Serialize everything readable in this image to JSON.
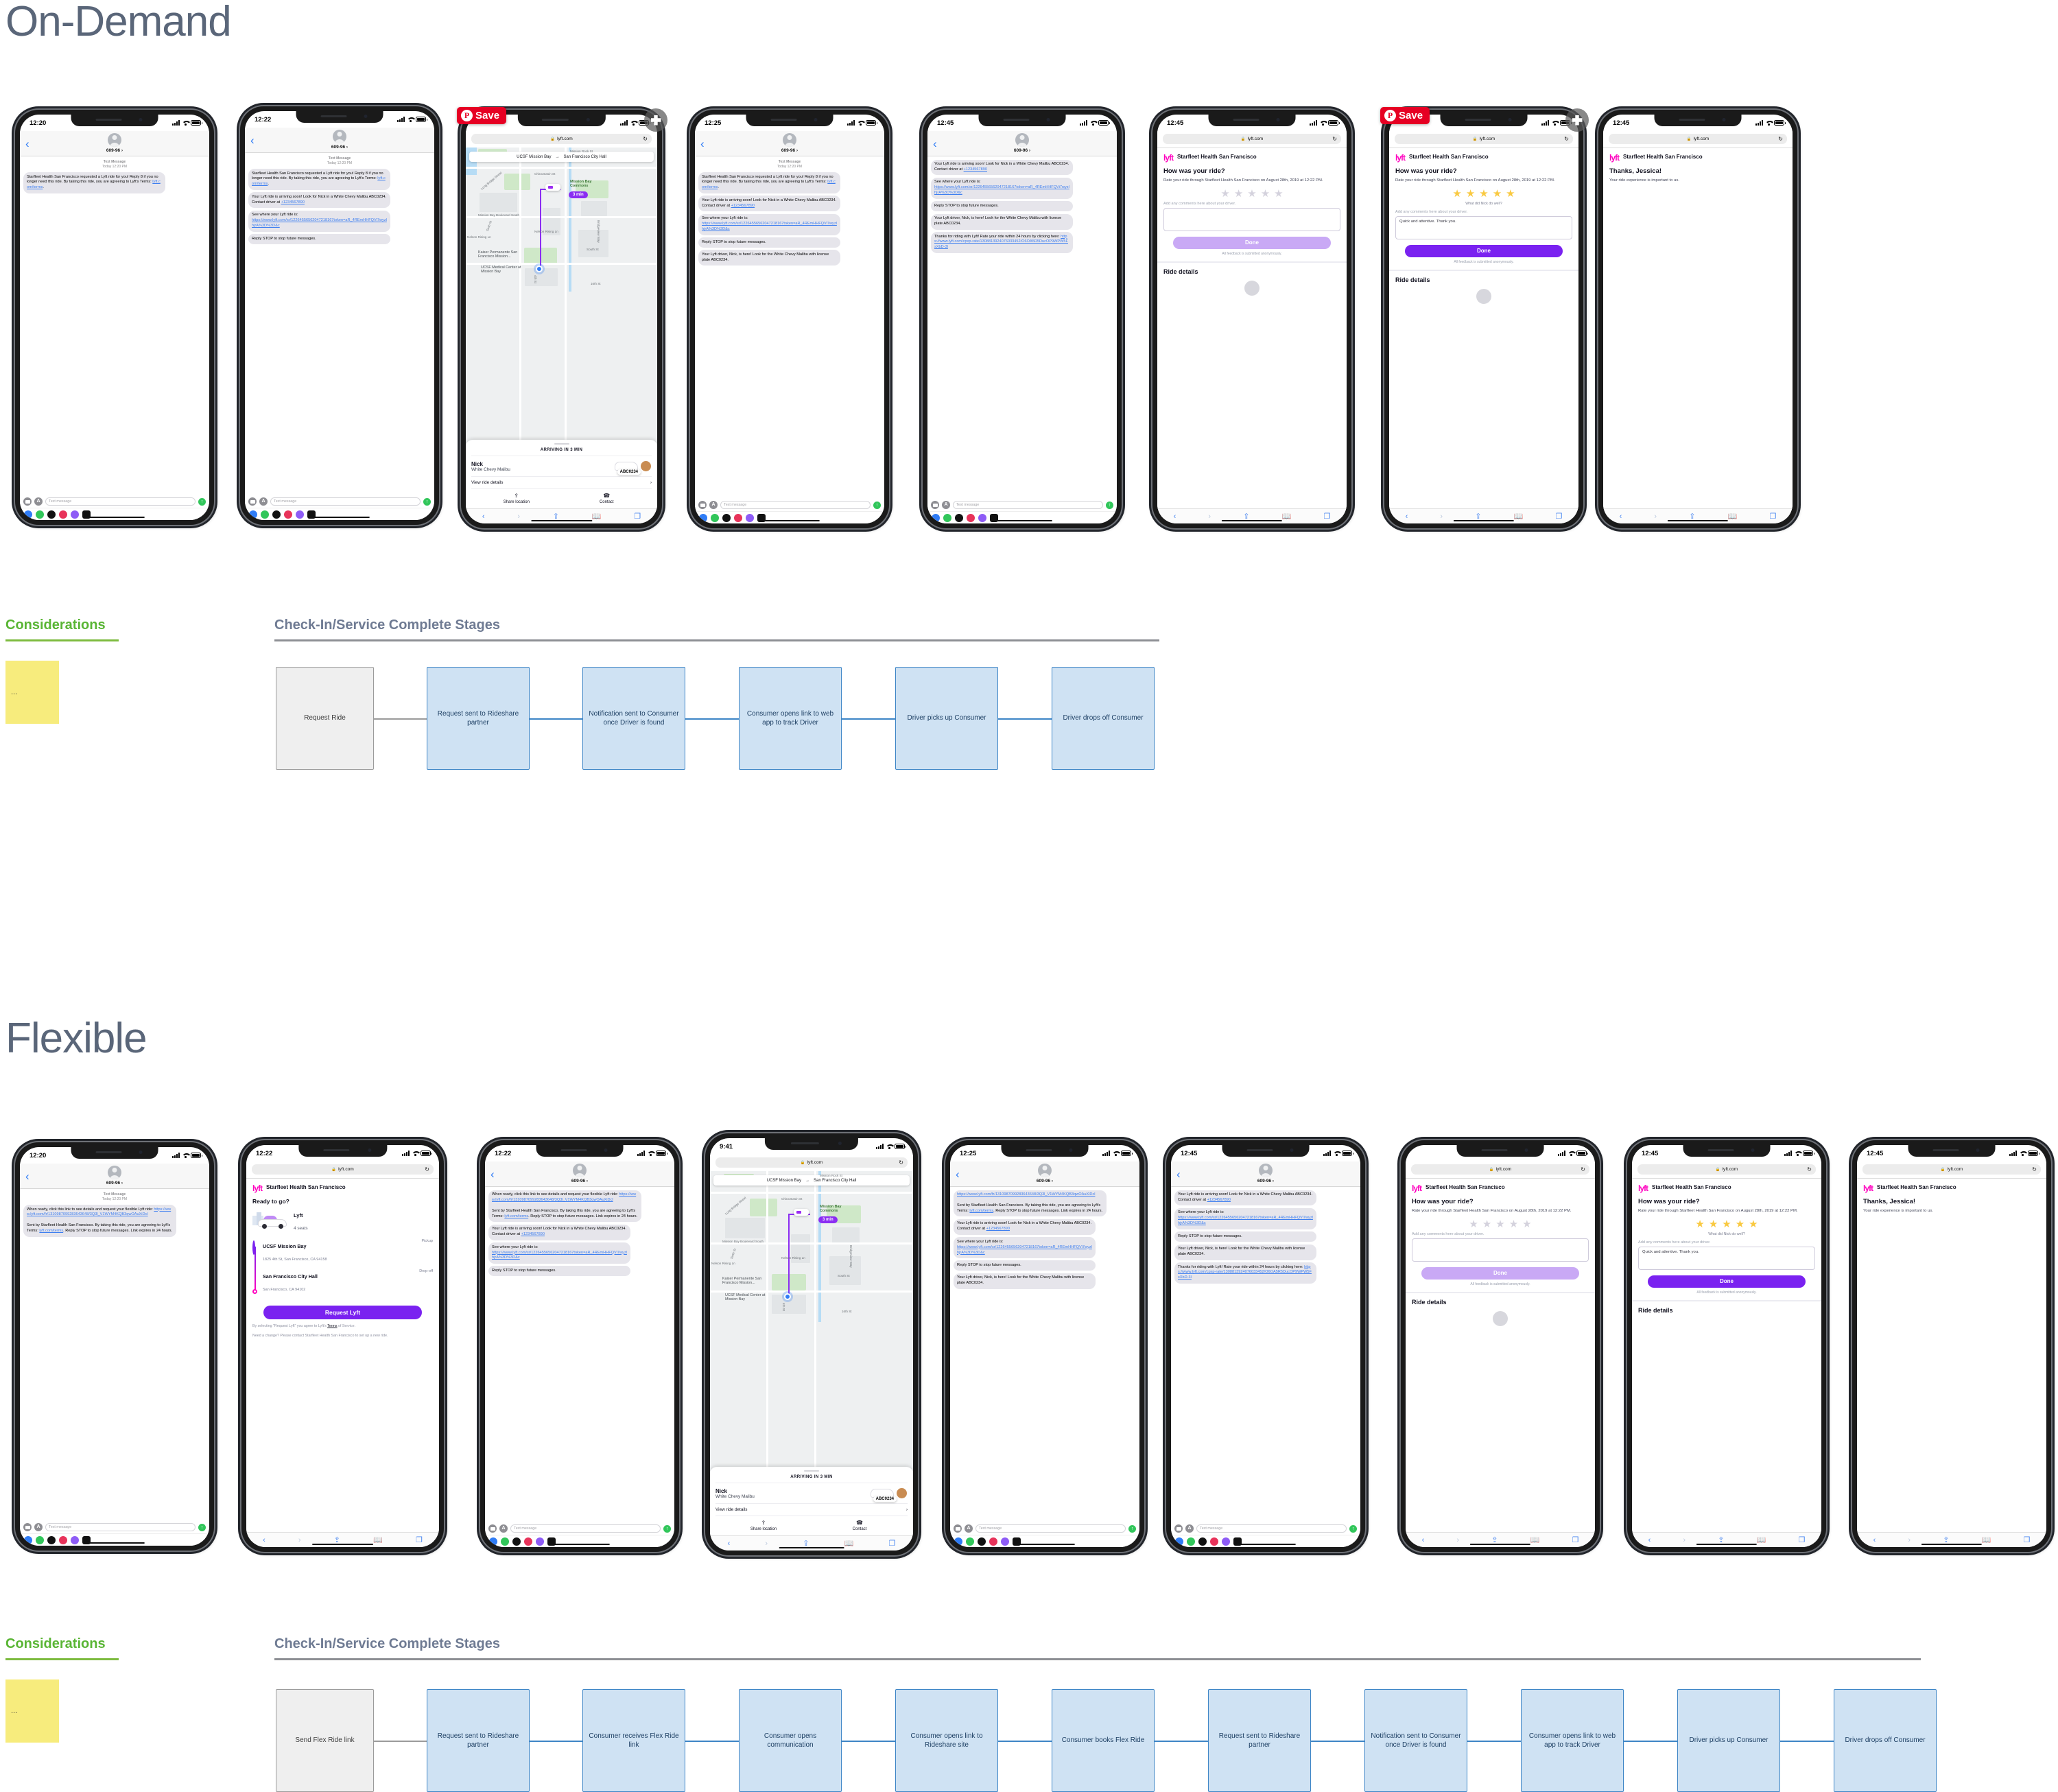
{
  "sections": {
    "ondemand": {
      "title": "On-Demand"
    },
    "flexible": {
      "title": "Flexible"
    }
  },
  "considerations": {
    "title": "Considerations",
    "note": "..."
  },
  "stages": {
    "title": "Check-In/Service Complete Stages"
  },
  "sms": {
    "contact": "609-96",
    "text_message_label": "Text Message",
    "timestamp": "Today 12:20 PM",
    "input_placeholder": "Text message",
    "msg_request": "Starfleet Health San Francisco requested a Lyft ride for you! Reply 8 if you no longer need this ride. By taking this ride, you are agreeing to Lyft's Terms: ",
    "msg_request_link": "lyft.com/terms",
    "msg_arriving_a": "Your Lyft ride is arriving soon! Look for Nick in a White Chevy Malibu ABC0234. Contact driver at ",
    "msg_arriving_link": "+1234567890",
    "msg_track_a": "See where your Lyft ride is:",
    "msg_track_link": "https://www.lyft.com/sr/12264556562047218167token=aR_4REmHHFQVi7wyzlhjrA%3D%3D&c",
    "msg_stop": "Reply STOP to stop future messages.",
    "msg_here": "Your Lyft driver, Nick, is here! Look for the White Chevy Malibu with license plate ABC0234.",
    "msg_rate_a": "Thanks for riding with Lyft! Rate your ride within 24 hours by clicking here: ",
    "msg_rate_link": "https://www.lyft.com/cpxp-rate/1308813924076033452/O6OA5R5DucOP9WPW5FsXbD-3l",
    "msg_flex_a": "When ready, click this link to see details and request your flexible Lyft ride: ",
    "msg_flex_link": "https://www.lyft.com/fr/1310987099283643648/3Q3l_V1WYM4KQB3qwOAuXiDcl",
    "msg_flex_b": "Sent by Starfleet Health San Francisco. By taking this ride, you are agreeing to Lyft's Terms: ",
    "msg_flex_b_link": "lyft.com/terms",
    "msg_flex_b_tail": ". Reply STOP to stop future messages. Link expires in 24 hours."
  },
  "browser": {
    "url": "lyft.com",
    "lock_icon": "lock-icon",
    "reload_icon": "reload-icon"
  },
  "rating": {
    "logo": "lyft",
    "org": "Starfleet Health San Francisco",
    "heading": "How was your ride?",
    "sub": "Rate your ride through Starfleet Health San Francisco on August 28th, 2019 at 12:22 PM.",
    "star_caption": "What did Nick do well?",
    "comments_label": "Add any comments here about your driver.",
    "comment_value": "Quick and attentive. Thank you.",
    "done": "Done",
    "anon": "All feedback is submitted anonymously.",
    "ride_details": "Ride details",
    "stars_empty": 0,
    "stars_filled": 5,
    "color_pale": "#c9a9f5",
    "color_solid": "#7a22f0",
    "color_star": "#f9c941"
  },
  "thanks": {
    "org": "Starfleet Health San Francisco",
    "heading": "Thanks, Jessica!",
    "sub": "Your ride experience is important to us."
  },
  "ready": {
    "org": "Starfleet Health San Francisco",
    "heading": "Ready to go?",
    "ride_type": "Lyft",
    "seats": "4 seats",
    "pickup_name": "UCSF Mission Bay",
    "pickup_addr": "1825 4th St, San Francisco, CA 94158",
    "pickup_tag": "Pickup",
    "dropoff_name": "San Francisco City Hall",
    "dropoff_addr": "San Francisco, CA 94102",
    "dropoff_tag": "Drop-off",
    "cta": "Request Lyft",
    "terms_a": "By selecting \"Request Lyft\" you agree to Lyft's ",
    "terms_link": "Terms",
    "terms_b": " of Service.",
    "change": "Need a change? Please contact Starfleet Health San Francisco to set up a new ride."
  },
  "map": {
    "origin": "UCSF Mission Bay",
    "destination": "San Francisco City Hall",
    "eta_badge": "3 min",
    "arriving": "ARRIVING IN 3 MIN",
    "driver_name": "Nick",
    "driver_car": "White Chevy Malibu",
    "plate": "ABC0234",
    "view_details": "View ride details",
    "share": "Share location",
    "contact": "Contact",
    "labels": {
      "mission_rock": "Mission Rock St",
      "china_basin": "China Basin St",
      "long_bridge": "Long Bridge Street",
      "mission_bay_blvd": "Mission Bay Boulevard South",
      "sixth_st": "Sixth St",
      "nelson_rising": "Nelson Rising Ln",
      "nelson_rising2": "Nelson Rising Ln",
      "mission_bay_commons": "Mission Bay Commons",
      "bridgeview": "Bridgeview Way",
      "south_st": "South St",
      "kaiser": "Kaiser Permanente San Francisco Mission...",
      "ucsf_med": "UCSF Medical Center at Mission Bay",
      "fourth_st": "4th St",
      "sixteenth": "16th St",
      "tunnel": "Tunnel St"
    }
  },
  "pinterest": {
    "save_label": "Save",
    "logo": "pinterest-icon",
    "more": "more-options-icon"
  },
  "statusbars": {
    "t1220": "12:20",
    "t1222": "12:22",
    "t1225": "12:25",
    "t1245": "12:45",
    "t941": "9:41"
  },
  "flow_ondemand": {
    "steps": [
      "Request Ride",
      "Request sent to Rideshare partner",
      "Notification sent to Consumer once Driver is found",
      "Consumer opens link to web app to track Driver",
      "Driver picks up Consumer",
      "Driver drops off Consumer"
    ]
  },
  "flow_flexible": {
    "steps": [
      "Send Flex Ride link",
      "Request sent to Rideshare partner",
      "Consumer receives Flex Ride link",
      "Consumer opens communication",
      "Consumer opens link to Rideshare site",
      "Consumer books Flex Ride",
      "Request sent to Rideshare partner",
      "Notification sent to Consumer once Driver is found",
      "Consumer opens link to web app to track Driver",
      "Driver picks up Consumer",
      "Driver drops off Consumer"
    ]
  }
}
